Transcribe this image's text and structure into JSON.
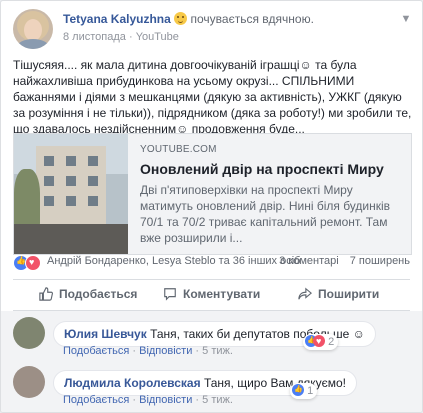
{
  "post": {
    "author": "Tetyana Kalyuzhna",
    "feeling": "почувається вдячною.",
    "date": "8 листопада",
    "source": "YouTube",
    "text": "Тішусяяя.... як мала дитина довгоочікуваній іграшці☺ та була найжахливіша прибудинкова на усьому окрузі... СПІЛЬНИМИ бажаннями і діями з мешканцями (дякую за активність), УЖКГ (дякую за розуміння і не тільки)), підрядником (дяка за роботу!) ми зробили те, що здавалось нездійсненним☺ продовження буде..."
  },
  "link_card": {
    "domain": "YOUTUBE.COM",
    "title": "Оновлений двір на проспекті Миру",
    "description": "Дві п'ятиповерхівки на проспекті Миру матимуть оновлений двір. Нині біля будинків 70/1 та 70/2 триває капітальний ремонт. Там вже розширили і..."
  },
  "reactions": {
    "names": "Андрій Бондаренко, Lesya Steblo та 36 інших осіб",
    "comments_count": "3 коментарі",
    "shares_count": "7 поширень",
    "icons": [
      "like-icon",
      "love-icon"
    ]
  },
  "actions": {
    "like": "Подобається",
    "comment": "Коментувати",
    "share": "Поширити"
  },
  "comments": [
    {
      "author": "Юлия Шевчук",
      "text": "Таня, таких би депутатов побольше ☺",
      "like_label": "Подобається",
      "reply_label": "Відповісти",
      "time": "5 тиж.",
      "reaction_count": "2"
    },
    {
      "author": "Людмила Королевская",
      "text": "Таня, щиро Вам дякуємо!",
      "like_label": "Подобається",
      "reply_label": "Відповісти",
      "time": "5 тиж.",
      "reaction_count": "1"
    }
  ],
  "colors": {
    "link_blue": "#365899",
    "like_blue": "#4a7ef5",
    "love_red": "#f25268",
    "muted_grey": "#90949c"
  }
}
